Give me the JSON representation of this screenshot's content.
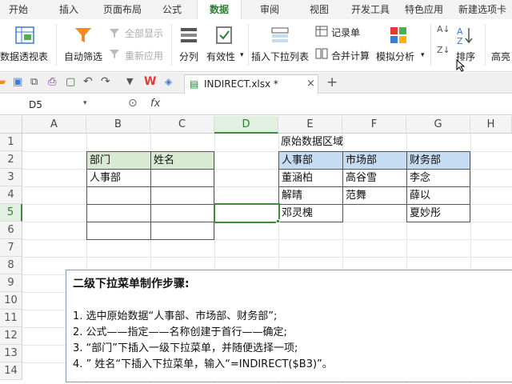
{
  "menu": {
    "tabs": [
      "开始",
      "插入",
      "页面布局",
      "公式",
      "数据",
      "审阅",
      "视图",
      "开发工具",
      "特色应用",
      "新建选项卡"
    ],
    "active_tab": "数据"
  },
  "ribbon": {
    "pivot_table": "数据透视表",
    "auto_filter": "自动筛选",
    "show_all": "全部显示",
    "reapply": "重新应用",
    "split_column": "分列",
    "validation": "有效性",
    "insert_dropdown": "插入下拉列表",
    "record_form": "记录单",
    "merge_calc": "合并计算",
    "simulate": "模拟分析",
    "sort": "排序",
    "highlight": "高亮"
  },
  "document": {
    "filename": "INDIRECT.xlsx *"
  },
  "formula_bar": {
    "cell_ref": "D5",
    "fx_label": "fx",
    "formula": ""
  },
  "grid": {
    "columns": [
      "A",
      "B",
      "C",
      "D",
      "E",
      "F",
      "G",
      "H"
    ],
    "rows": [
      "1",
      "2",
      "3",
      "4",
      "5",
      "6",
      "7",
      "8",
      "9",
      "10",
      "11",
      "12",
      "13",
      "14"
    ],
    "selected_column": "D",
    "selected_row": "5"
  },
  "input_table": {
    "headers": [
      "部门",
      "姓名"
    ],
    "rows": [
      [
        "人事部",
        ""
      ],
      [
        "",
        ""
      ],
      [
        "",
        ""
      ],
      [
        "",
        ""
      ]
    ]
  },
  "source_data": {
    "title": "原始数据区域",
    "headers": [
      "人事部",
      "市场部",
      "财务部"
    ],
    "rows": [
      [
        "董涵柏",
        "高谷雪",
        "李念"
      ],
      [
        "解晴",
        "范舞",
        "薛以"
      ],
      [
        "邓灵槐",
        "",
        "夏妙彤"
      ]
    ]
  },
  "notes": {
    "title": "二级下拉菜单制作步骤:",
    "lines": [
      "1. 选中原始数据“人事部、市场部、财务部”;",
      "2. 公式——指定——名称创建于首行——确定;",
      "3. “部门”下插入一级下拉菜单，并随便选择一项;",
      "4. ” 姓名“下插入下拉菜单，输入“=INDIRECT($B3)”。"
    ]
  },
  "colors": {
    "accent_green": "#2e7d32",
    "header_green": "#d9ead3",
    "header_blue": "#c6dcf2"
  }
}
